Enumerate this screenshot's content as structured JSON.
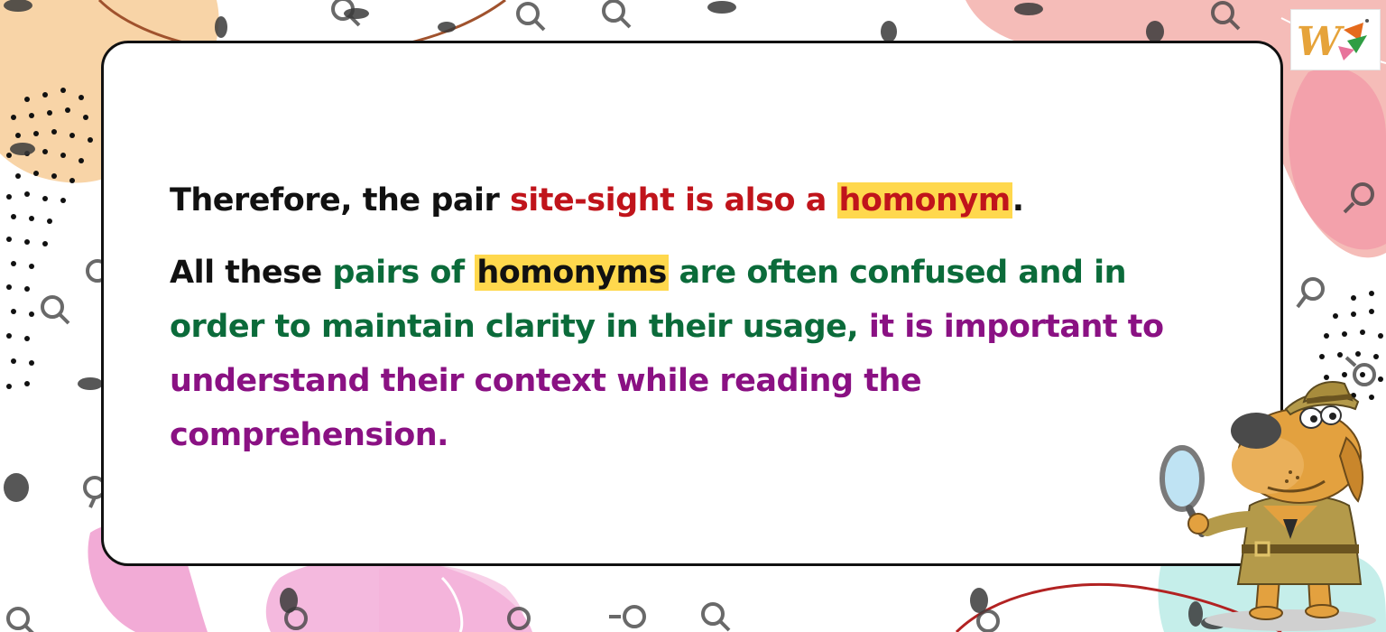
{
  "slide": {
    "line1": {
      "black": "Therefore, the pair ",
      "red": "site-sight is also a ",
      "highlight": "homonym",
      "end": "."
    },
    "para2": {
      "black": "All these ",
      "green1": "pairs of ",
      "highlight": "homonyms",
      "green2": " are often confused and in order to maintain clarity in their usage, ",
      "purple": "it is important to understand their context while reading the comprehension."
    }
  },
  "colors": {
    "text_black": "#111111",
    "text_red": "#c0141b",
    "text_green": "#0b6b3a",
    "text_purple": "#8a1183",
    "highlight_yellow": "#ffd84d",
    "card_border": "#111111"
  },
  "decorations": {
    "background_pattern": "watercolor-blobs-with-dots-and-magnifier-icons",
    "logo_icon": "w-letter-logo-icon",
    "mascot": "detective-dog-with-magnifying-glass"
  }
}
